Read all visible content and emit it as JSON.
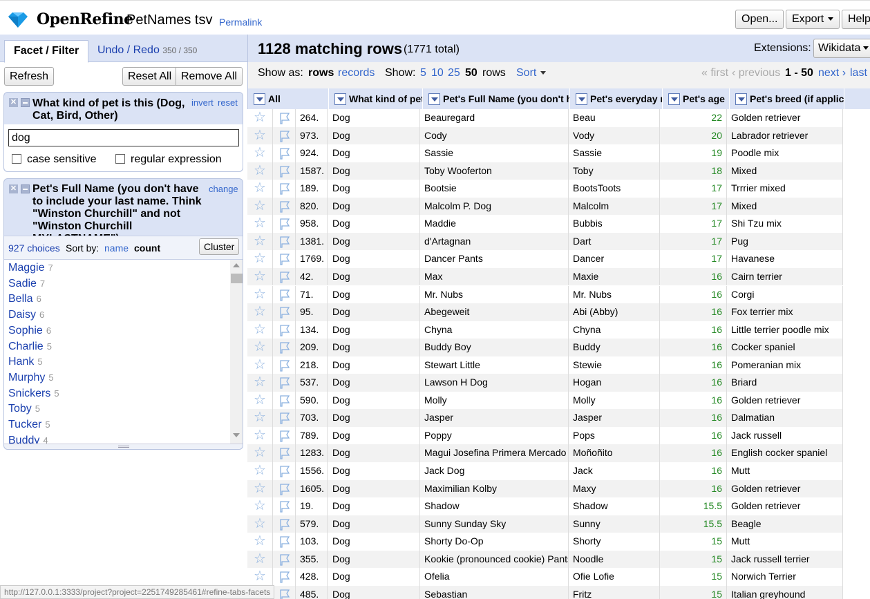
{
  "header": {
    "brand": "OpenRefine",
    "project_name": "PetNames tsv",
    "permalink": "Permalink",
    "open_label": "Open...",
    "export_label": "Export",
    "help_label": "Help"
  },
  "left": {
    "tab_facet": "Facet / Filter",
    "tab_undo": "Undo / Redo",
    "undo_count": "350 / 350",
    "refresh": "Refresh",
    "reset_all": "Reset All",
    "remove_all": "Remove All",
    "facet1": {
      "title": "What kind of pet is this (Dog, Cat, Bird, Other)",
      "invert": "invert",
      "reset": "reset",
      "value": "dog",
      "case_sensitive": "case sensitive",
      "regex": "regular expression"
    },
    "facet2": {
      "title": "Pet's Full Name (you don't have to include your last name. Think \"Winston Churchill\" and not \"Winston Churchill MYLASTNAME\")",
      "change": "change",
      "choices": "927 choices",
      "sort_by": "Sort by:",
      "sort_name": "name",
      "sort_count": "count",
      "cluster": "Cluster",
      "items": [
        {
          "name": "Maggie",
          "count": "7"
        },
        {
          "name": "Sadie",
          "count": "7"
        },
        {
          "name": "Bella",
          "count": "6"
        },
        {
          "name": "Daisy",
          "count": "6"
        },
        {
          "name": "Sophie",
          "count": "6"
        },
        {
          "name": "Charlie",
          "count": "5"
        },
        {
          "name": "Hank",
          "count": "5"
        },
        {
          "name": "Murphy",
          "count": "5"
        },
        {
          "name": "Snickers",
          "count": "5"
        },
        {
          "name": "Toby",
          "count": "5"
        },
        {
          "name": "Tucker",
          "count": "5"
        },
        {
          "name": "Buddy",
          "count": "4"
        }
      ]
    }
  },
  "grid": {
    "matching": "1128 matching rows",
    "total": "(1771 total)",
    "extensions": "Extensions:",
    "wikidata": "Wikidata",
    "show_as": "Show as:",
    "rows_mode": "rows",
    "records_mode": "records",
    "show": "Show:",
    "page_sizes": [
      "5",
      "10",
      "25",
      "50"
    ],
    "rows_word": "rows",
    "sort": "Sort",
    "first": "« first",
    "previous": "‹ previous",
    "range": "1 - 50",
    "next": "next ›",
    "last": "last",
    "columns": [
      "All",
      "What kind of pet",
      "Pet's Full Name (you don't ha",
      "Pet's everyday n",
      "Pet's age",
      "Pet's breed (if applica"
    ],
    "rows": [
      [
        "264.",
        "Dog",
        "Beauregard",
        "Beau",
        "22",
        "Golden retriever"
      ],
      [
        "973.",
        "Dog",
        "Cody",
        "Vody",
        "20",
        "Labrador retriever"
      ],
      [
        "924.",
        "Dog",
        "Sassie",
        "Sassie",
        "19",
        "Poodle mix"
      ],
      [
        "1587.",
        "Dog",
        "Toby Wooferton",
        "Toby",
        "18",
        "Mixed"
      ],
      [
        "189.",
        "Dog",
        "Bootsie",
        "BootsToots",
        "17",
        "Trrrier mixed"
      ],
      [
        "820.",
        "Dog",
        "Malcolm P. Dog",
        "Malcolm",
        "17",
        "Mixed"
      ],
      [
        "958.",
        "Dog",
        "Maddie",
        "Bubbis",
        "17",
        "Shi Tzu mix"
      ],
      [
        "1381.",
        "Dog",
        "d'Artagnan",
        "Dart",
        "17",
        "Pug"
      ],
      [
        "1769.",
        "Dog",
        "Dancer Pants",
        "Dancer",
        "17",
        "Havanese"
      ],
      [
        "42.",
        "Dog",
        "Max",
        "Maxie",
        "16",
        "Cairn terrier"
      ],
      [
        "71.",
        "Dog",
        "Mr. Nubs",
        "Mr. Nubs",
        "16",
        "Corgi"
      ],
      [
        "95.",
        "Dog",
        "Abegeweit",
        "Abi (Abby)",
        "16",
        "Fox terrier mix"
      ],
      [
        "134.",
        "Dog",
        "Chyna",
        "Chyna",
        "16",
        "Little terrier poodle mix"
      ],
      [
        "209.",
        "Dog",
        "Buddy Boy",
        "Buddy",
        "16",
        "Cocker spaniel"
      ],
      [
        "218.",
        "Dog",
        "Stewart Little",
        "Stewie",
        "16",
        "Pomeranian mix"
      ],
      [
        "537.",
        "Dog",
        "Lawson H Dog",
        "Hogan",
        "16",
        "Briard"
      ],
      [
        "590.",
        "Dog",
        "Molly",
        "Molly",
        "16",
        "Golden retriever"
      ],
      [
        "703.",
        "Dog",
        "Jasper",
        "Jasper",
        "16",
        "Dalmatian"
      ],
      [
        "789.",
        "Dog",
        "Poppy",
        "Pops",
        "16",
        "Jack russell"
      ],
      [
        "1283.",
        "Dog",
        "Magui Josefina Primera Mercado",
        "Moñoñito",
        "16",
        "English cocker spaniel"
      ],
      [
        "1556.",
        "Dog",
        "Jack Dog",
        "Jack",
        "16",
        "Mutt"
      ],
      [
        "1605.",
        "Dog",
        "Maximilian Kolby",
        "Maxy",
        "16",
        "Golden retriever"
      ],
      [
        "19.",
        "Dog",
        "Shadow",
        "Shadow",
        "15.5",
        "Golden retriever"
      ],
      [
        "579.",
        "Dog",
        "Sunny Sunday Sky",
        "Sunny",
        "15.5",
        "Beagle"
      ],
      [
        "103.",
        "Dog",
        "Shorty Do-Op",
        "Shorty",
        "15",
        "Mutt"
      ],
      [
        "355.",
        "Dog",
        "Kookie (pronounced cookie) Pants",
        "Noodle",
        "15",
        "Jack russell terrier"
      ],
      [
        "428.",
        "Dog",
        "Ofelia",
        "Ofie Lofie",
        "15",
        "Norwich Terrier"
      ],
      [
        "485.",
        "Dog",
        "Sebastian",
        "Fritz",
        "15",
        "Italian greyhound"
      ]
    ]
  },
  "status_url": "http://127.0.0.1:3333/project?project=2251749285461#refine-tabs-facets",
  "colors": {
    "accent_bg": "#dbe3f5",
    "link": "#3366cc",
    "age": "#228822"
  }
}
